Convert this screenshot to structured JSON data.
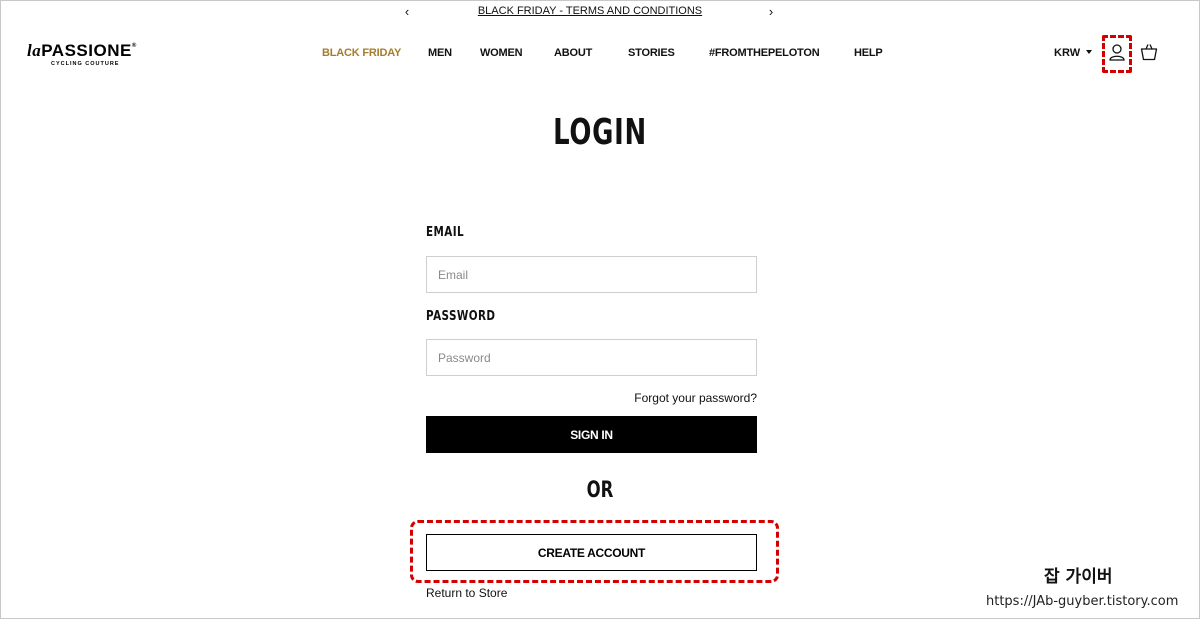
{
  "announcement": {
    "prev_glyph": "‹",
    "next_glyph": "›",
    "text": "BLACK FRIDAY - TERMS AND CONDITIONS"
  },
  "brand": {
    "name_prefix": "la",
    "name": "PASSIONE",
    "registered": "®",
    "tagline": "CYCLING COUTURE"
  },
  "nav": {
    "items": [
      {
        "label": "BLACK FRIDAY"
      },
      {
        "label": "MEN"
      },
      {
        "label": "WOMEN"
      },
      {
        "label": "ABOUT"
      },
      {
        "label": "STORIES"
      },
      {
        "label": "#FROMTHEPELOTON"
      },
      {
        "label": "HELP"
      }
    ],
    "accent_color": "#a57c2c"
  },
  "header": {
    "currency": "KRW",
    "icons": [
      "user-icon",
      "cart-icon"
    ]
  },
  "login": {
    "title": "LOGIN",
    "email_label": "EMAIL",
    "email_placeholder": "Email",
    "email_value": "",
    "password_label": "PASSWORD",
    "password_placeholder": "Password",
    "password_value": "",
    "forgot": "Forgot your password?",
    "sign_in": "SIGN IN",
    "or": "OR",
    "create_account": "CREATE ACCOUNT",
    "return": "Return to Store"
  },
  "annotations": {
    "highlight_color": "#d40000"
  },
  "watermark": {
    "name": "잡 가이버",
    "url": "https://JAb-guyber.tistory.com"
  }
}
